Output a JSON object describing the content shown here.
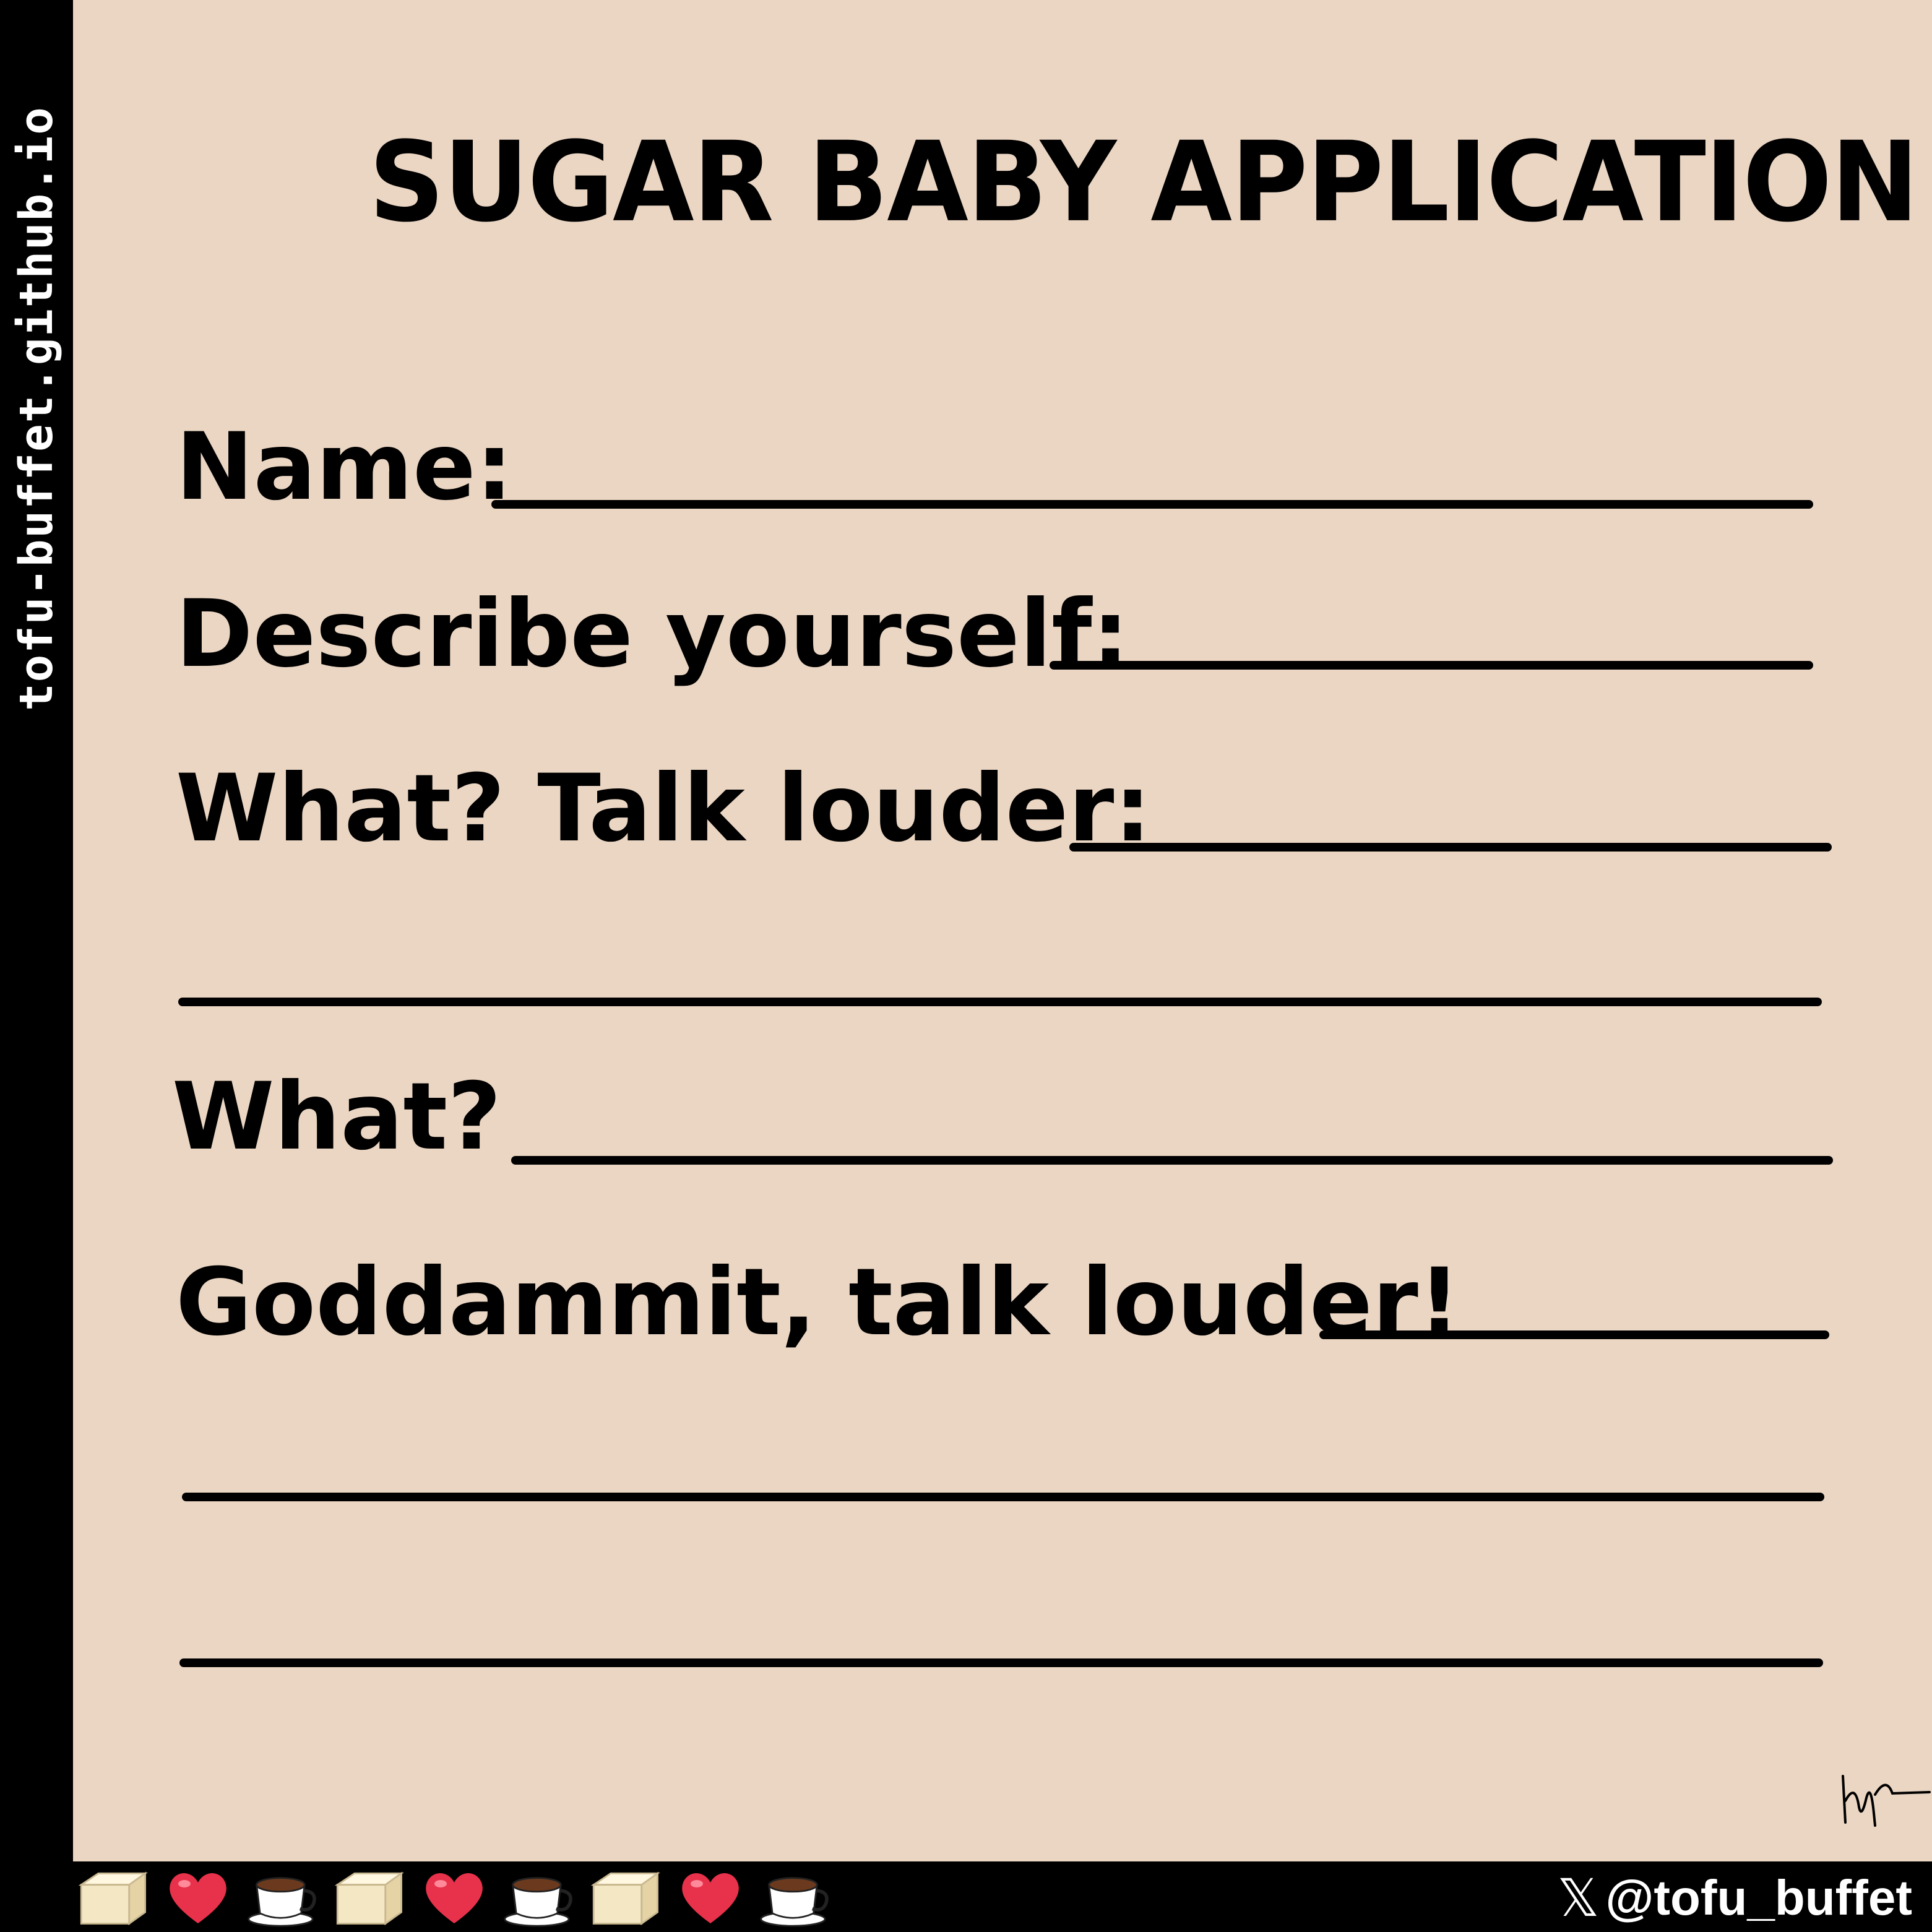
{
  "sidebar": {
    "text": "tofu-buffet.github.io"
  },
  "form": {
    "title": "SUGAR BABY APPLICATION",
    "fields": [
      {
        "label": "Name:"
      },
      {
        "label": "Describe yourself:"
      },
      {
        "label": "What? Talk louder:"
      },
      {
        "label": "What?"
      },
      {
        "label": "Goddammit, talk louder!"
      }
    ]
  },
  "footer": {
    "icons": [
      "tofu-icon",
      "heart-icon",
      "coffee-icon",
      "tofu-icon",
      "heart-icon",
      "coffee-icon",
      "tofu-icon",
      "heart-icon",
      "coffee-icon"
    ],
    "x_glyph": "𝕏",
    "handle": "@tofu_buffet"
  },
  "colors": {
    "paper": "#ebd6c3",
    "ink": "#000000",
    "heart": "#e8314a",
    "tofu": "#f3e7c4"
  }
}
